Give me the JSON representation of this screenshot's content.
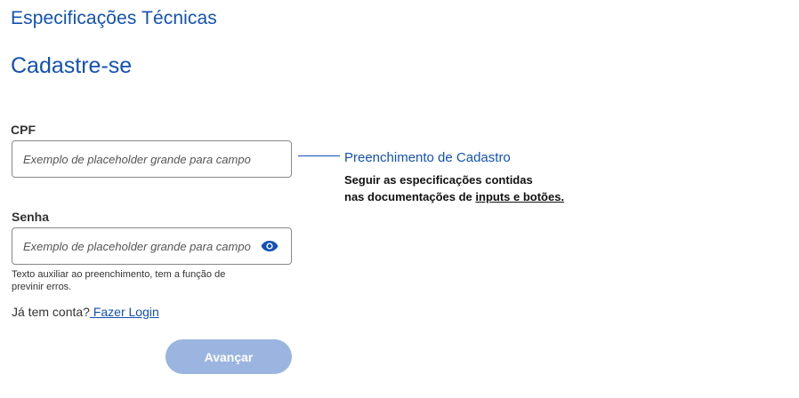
{
  "page": {
    "heading": "Especificações Técnicas",
    "form_title": "Cadastre-se"
  },
  "form": {
    "cpf": {
      "label": "CPF",
      "placeholder": "Exemplo de placeholder grande para campo"
    },
    "password": {
      "label": "Senha",
      "placeholder": "Exemplo de placeholder grande para campo",
      "toggle_icon": "eye-icon",
      "helper_text": "Texto auxiliar ao preenchimento, tem a função de previnir erros."
    },
    "login_prompt": "Já tem conta?",
    "login_link": " Fazer Login",
    "submit_label": "Avançar"
  },
  "annotation": {
    "title": "Preenchimento de Cadastro",
    "line1": "Seguir as especificações contidas",
    "line2_prefix": "nas documentações de ",
    "line2_link": "inputs e botões."
  },
  "colors": {
    "primary": "#1351b4",
    "button_disabled": "#9bb5e0",
    "border": "#888888",
    "text": "#333333"
  }
}
